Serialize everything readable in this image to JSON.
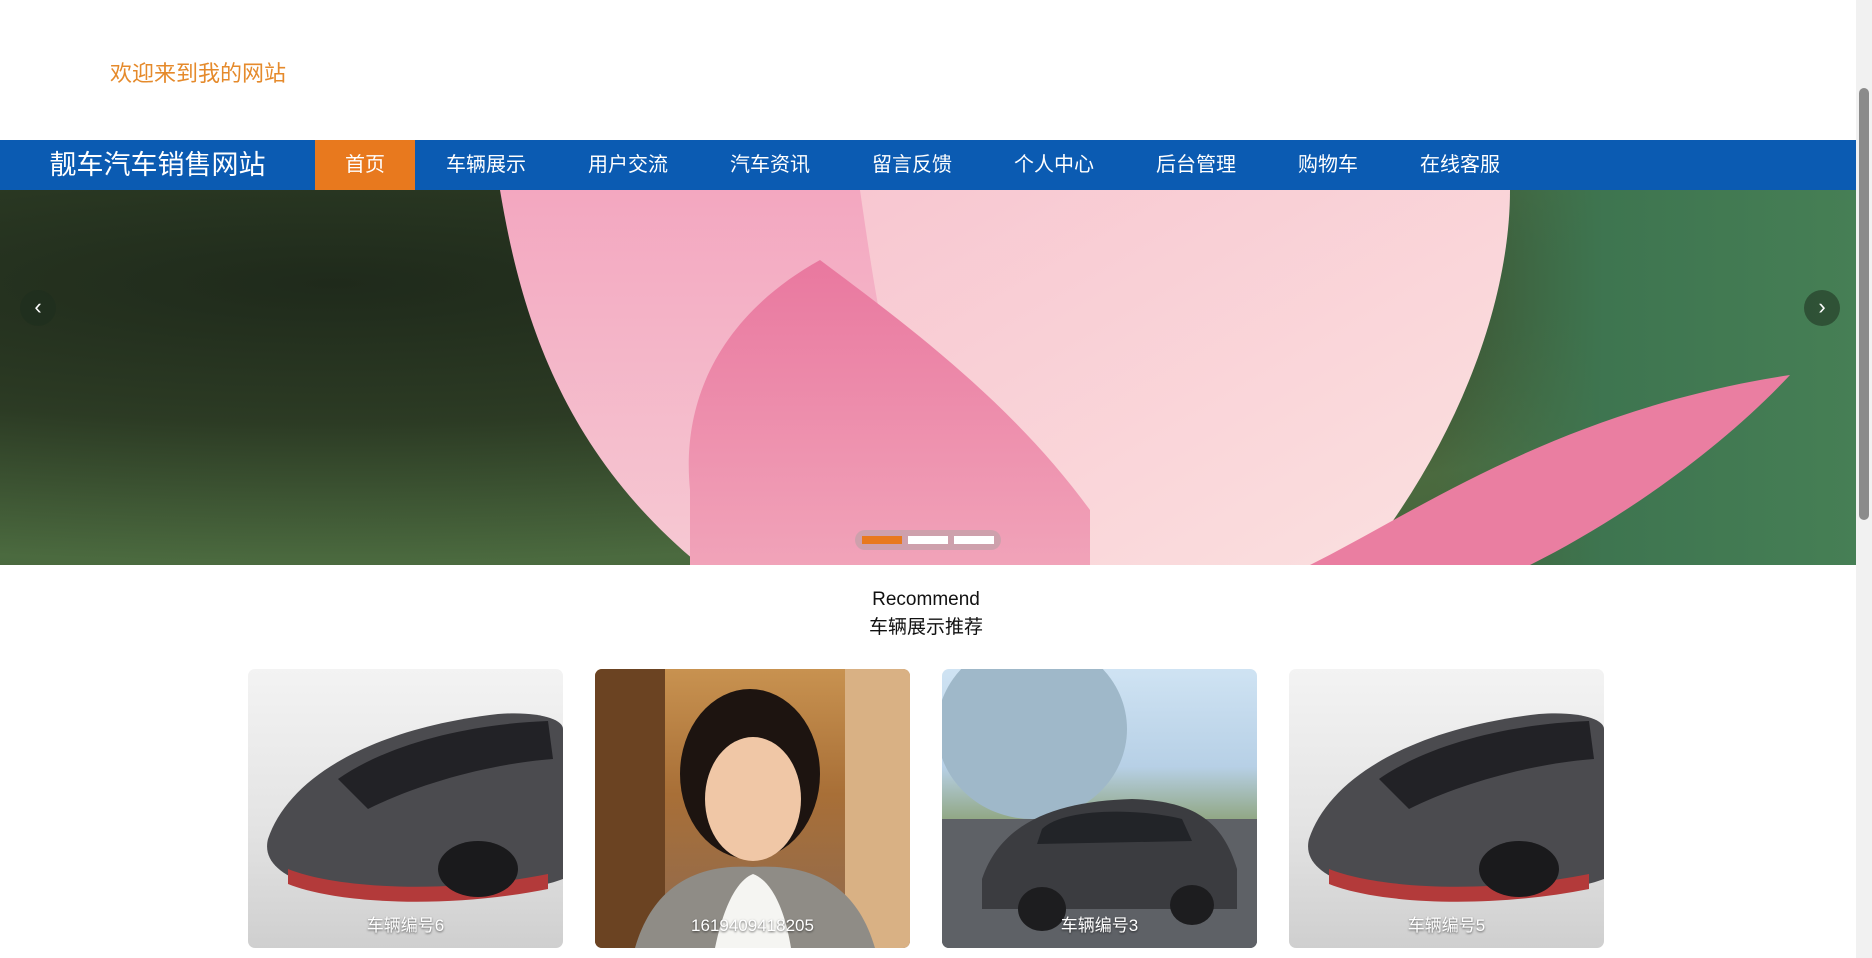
{
  "header": {
    "welcome_text": "欢迎来到我的网站"
  },
  "nav": {
    "brand": "靓车汽车销售网站",
    "items": [
      {
        "label": "首页",
        "active": true
      },
      {
        "label": "车辆展示",
        "active": false
      },
      {
        "label": "用户交流",
        "active": false
      },
      {
        "label": "汽车资讯",
        "active": false
      },
      {
        "label": "留言反馈",
        "active": false
      },
      {
        "label": "个人中心",
        "active": false
      },
      {
        "label": "后台管理",
        "active": false
      },
      {
        "label": "购物车",
        "active": false
      },
      {
        "label": "在线客服",
        "active": false
      }
    ]
  },
  "banner": {
    "prev_icon": "chevron-left-icon",
    "next_icon": "chevron-right-icon",
    "prev_glyph": "‹",
    "next_glyph": "›",
    "slide_count": 3,
    "active_slide": 1
  },
  "recommend": {
    "title_en": "Recommend",
    "title_cn": "车辆展示推荐",
    "cards": [
      {
        "label": "车辆编号6",
        "image": "sports-car"
      },
      {
        "label": "1619409418205",
        "image": "woman-portrait"
      },
      {
        "label": "车辆编号3",
        "image": "sedan-street"
      },
      {
        "label": "车辆编号5",
        "image": "sports-car"
      }
    ]
  },
  "colors": {
    "nav_bg": "#0b5bb2",
    "accent": "#e8791e",
    "welcome": "#e58a2b"
  }
}
